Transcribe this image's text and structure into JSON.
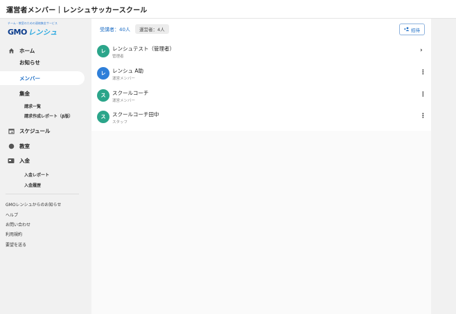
{
  "header": {
    "title": "運営者メンバー｜レンシュサッカースクール"
  },
  "logo": {
    "tagline": "チーム・教室のための連絡集金サービス",
    "brand_a": "GMO",
    "brand_b": "レンシュ"
  },
  "sidebar": {
    "home": "ホーム",
    "news": "お知らせ",
    "members": "メンバー",
    "collection": "集金",
    "billing_list": "請求一覧",
    "billing_report": "請求作成レポート（β版）",
    "schedule": "スケジュール",
    "classroom": "教室",
    "deposit": "入金",
    "deposit_report": "入金レポート",
    "deposit_history": "入金履歴",
    "footer_links": [
      "GMOレンシュからのお知らせ",
      "ヘルプ",
      "お問い合わせ",
      "利用規約",
      "要望を送る"
    ]
  },
  "main": {
    "attendees": "受講者：40人",
    "staff": "運営者：4人",
    "invite": "招待",
    "members": [
      {
        "initial": "レ",
        "name": "レンシュテスト（管理者）",
        "role": "管理者",
        "color": "#2ba58a",
        "action": "›"
      },
      {
        "initial": "レ",
        "name": "レンシュ A助",
        "role": "運営メンバー",
        "color": "#2f7fd9",
        "action": "⋮"
      },
      {
        "initial": "ス",
        "name": "スクールコーチ",
        "role": "運営メンバー",
        "color": "#2ba58a",
        "action": "⋮"
      },
      {
        "initial": "ス",
        "name": "スクールコーチ田中",
        "role": "スタッフ",
        "color": "#2ba58a",
        "action": "⋮"
      }
    ]
  }
}
